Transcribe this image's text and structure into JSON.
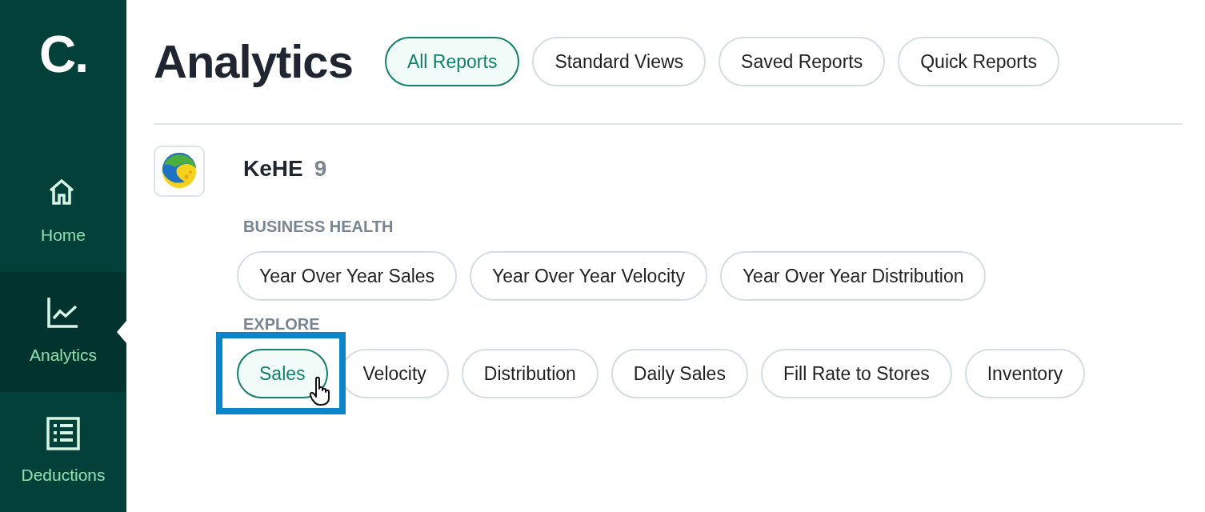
{
  "sidebar": {
    "logo": "C.",
    "items": [
      {
        "label": "Home",
        "kind": "home",
        "selected": false
      },
      {
        "label": "Analytics",
        "kind": "chart",
        "selected": true
      },
      {
        "label": "Deductions",
        "kind": "list",
        "selected": false
      }
    ]
  },
  "page": {
    "title": "Analytics"
  },
  "tabs": [
    {
      "label": "All Reports",
      "selected": true
    },
    {
      "label": "Standard Views",
      "selected": false
    },
    {
      "label": "Saved Reports",
      "selected": false
    },
    {
      "label": "Quick Reports",
      "selected": false
    }
  ],
  "source": {
    "name": "KeHE",
    "count": "9",
    "sections": [
      {
        "heading": "BUSINESS HEALTH",
        "reports": [
          {
            "label": "Year Over Year Sales",
            "selected": false,
            "highlighted": false
          },
          {
            "label": "Year Over Year Velocity",
            "selected": false,
            "highlighted": false
          },
          {
            "label": "Year Over Year Distribution",
            "selected": false,
            "highlighted": false
          }
        ]
      },
      {
        "heading": "EXPLORE",
        "reports": [
          {
            "label": "Sales",
            "selected": true,
            "highlighted": true
          },
          {
            "label": "Velocity",
            "selected": false,
            "highlighted": false
          },
          {
            "label": "Distribution",
            "selected": false,
            "highlighted": false
          },
          {
            "label": "Daily Sales",
            "selected": false,
            "highlighted": false
          },
          {
            "label": "Fill Rate to Stores",
            "selected": false,
            "highlighted": false
          },
          {
            "label": "Inventory",
            "selected": false,
            "highlighted": false
          }
        ]
      }
    ]
  }
}
